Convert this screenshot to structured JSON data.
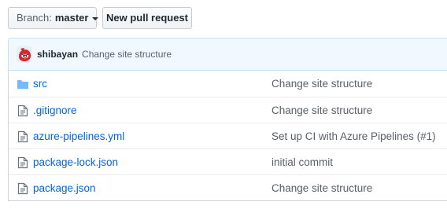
{
  "toolbar": {
    "branch_prefix": "Branch:",
    "branch_name": "master",
    "new_pull_request_label": "New pull request"
  },
  "latest_commit": {
    "author": "shibayan",
    "message": "Change site structure"
  },
  "files": [
    {
      "name": "src",
      "type": "directory",
      "icon": "folder-icon",
      "commit_message": "Change site structure"
    },
    {
      "name": ".gitignore",
      "type": "file",
      "icon": "file-icon",
      "commit_message": "Change site structure"
    },
    {
      "name": "azure-pipelines.yml",
      "type": "file",
      "icon": "file-icon",
      "commit_message": "Set up CI with Azure Pipelines (#1)"
    },
    {
      "name": "package-lock.json",
      "type": "file",
      "icon": "file-icon",
      "commit_message": "initial commit"
    },
    {
      "name": "package.json",
      "type": "file",
      "icon": "file-icon",
      "commit_message": "Change site structure"
    }
  ],
  "colors": {
    "link": "#0366d6",
    "commit_bar_bg": "#f1f8ff",
    "commit_bar_border": "#c8e1ff",
    "folder_icon": "#79b8ff",
    "file_icon": "#6a737d"
  }
}
